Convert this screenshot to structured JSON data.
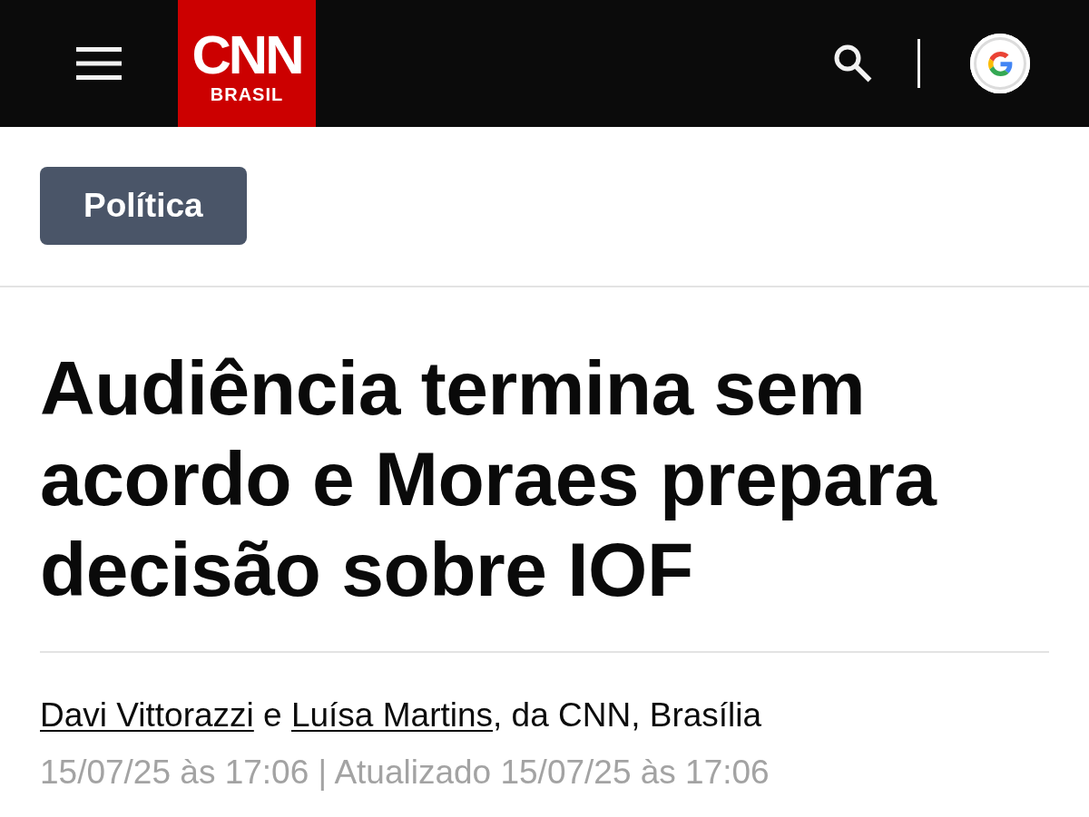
{
  "header": {
    "logo": {
      "wordmark": "CNN",
      "subtitle": "BRASIL"
    }
  },
  "category": {
    "label": "Política"
  },
  "article": {
    "headline": "Audiência termina sem acordo e Moraes prepara decisão sobre IOF",
    "byline": {
      "authors": [
        "Davi Vittorazzi",
        "Luísa Martins"
      ],
      "conjunction": "e",
      "suffix": ", da CNN, Brasília"
    },
    "timestamp": "15/07/25 às 17:06 | Atualizado 15/07/25 às 17:06"
  }
}
